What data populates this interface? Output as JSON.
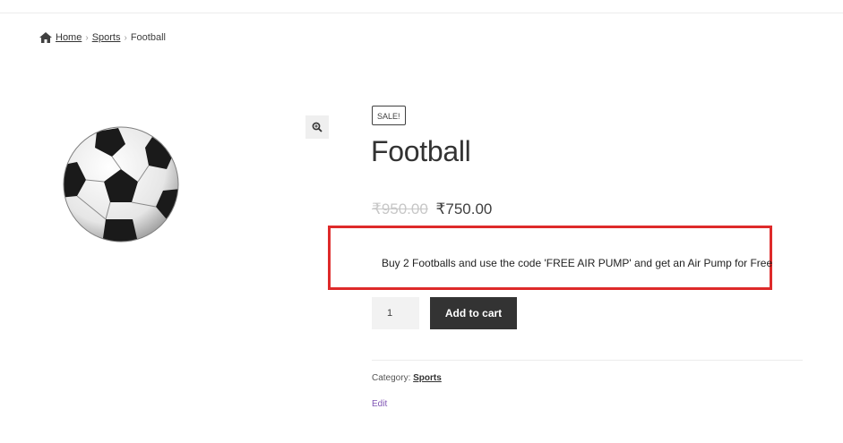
{
  "breadcrumb": {
    "home": "Home",
    "separator": "›",
    "category": "Sports",
    "current": "Football"
  },
  "product": {
    "badge": "SALE!",
    "title": "Football",
    "regular_price": "₹950.00",
    "sale_price": "₹750.00",
    "promo_text": "Buy 2 Footballs and use the code 'FREE AIR PUMP' and get an Air Pump for Free",
    "quantity": "1",
    "add_to_cart_label": "Add to cart",
    "category_label": "Category:",
    "category_link": "Sports",
    "edit_label": "Edit"
  },
  "icons": {
    "home": "home-icon",
    "zoom": "zoom-icon"
  },
  "colors": {
    "highlight_border": "#de2a2a",
    "button_bg": "#333333",
    "edit_link": "#7f54b3"
  }
}
